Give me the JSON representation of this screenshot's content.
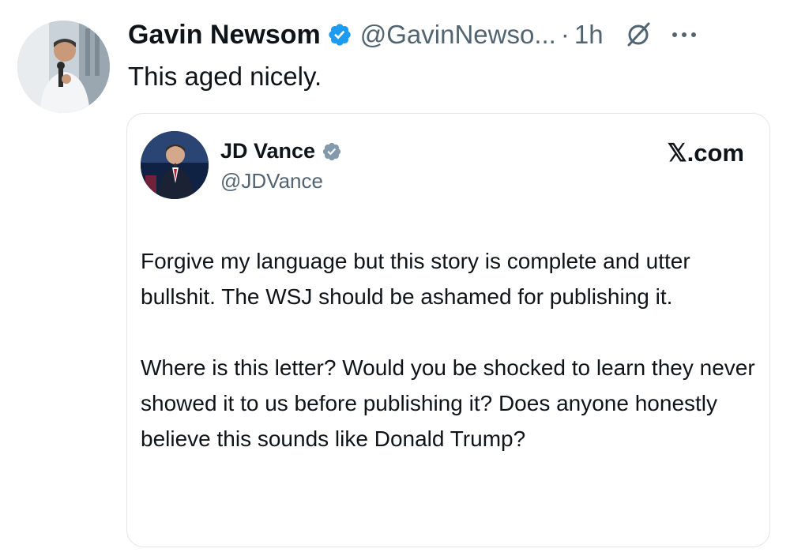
{
  "tweet": {
    "author_name": "Gavin Newsom",
    "handle": "@GavinNewso...",
    "separator": "·",
    "time": "1h",
    "text": "This aged nicely.",
    "avatar_icon": "avatar-photo",
    "verified_color": "#1d9bf0"
  },
  "quoted": {
    "author_name": "JD Vance",
    "handle": "@JDVance",
    "source": "𝕏.com",
    "verified_color": "#829aab",
    "paragraphs": [
      "Forgive my language but this story is complete and utter bullshit. The WSJ should be ashamed for publishing it.",
      "Where is this letter? Would you be shocked to learn they never showed it to us before publishing it? Does anyone honestly believe this sounds like Donald Trump?"
    ]
  }
}
